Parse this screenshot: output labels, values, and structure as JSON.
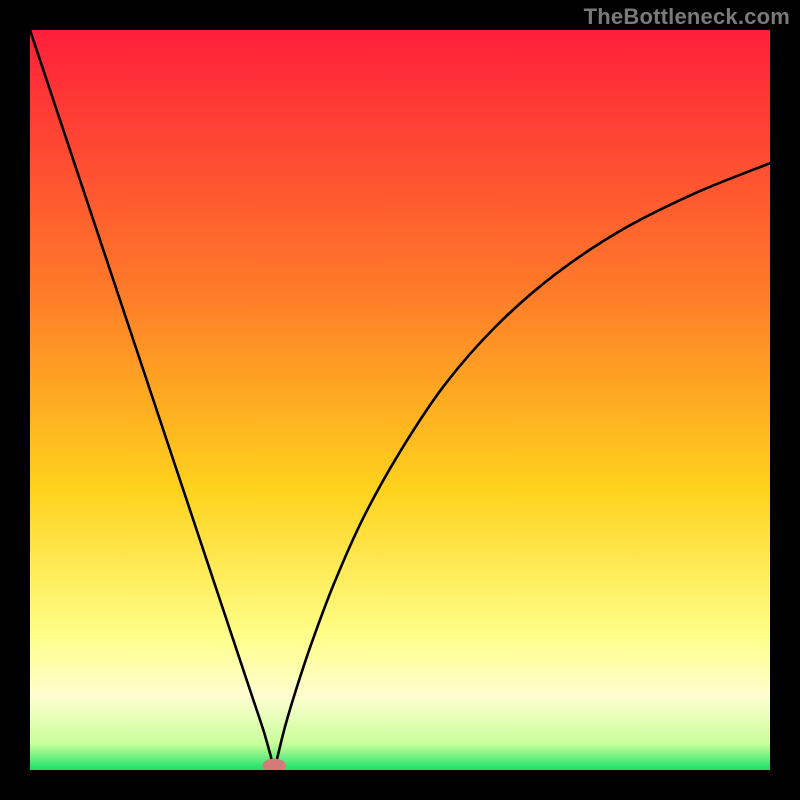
{
  "watermark": "TheBottleneck.com",
  "colors": {
    "frame": "#000000",
    "gradient_top": "#ff1f3a",
    "gradient_mid1": "#ff7a2a",
    "gradient_mid2": "#ffd21c",
    "gradient_mid3": "#fffacd",
    "gradient_bottom": "#18e06a",
    "curve": "#000000",
    "marker": "#d57a7a"
  },
  "chart_data": {
    "type": "line",
    "title": "",
    "xlabel": "",
    "ylabel": "",
    "xlim": [
      0,
      100
    ],
    "ylim": [
      0,
      100
    ],
    "minimum": {
      "x": 33,
      "y": 0
    },
    "marker": {
      "x": 33,
      "y": 0,
      "rx": 1.6,
      "ry": 1.0
    },
    "series": [
      {
        "name": "bottleneck-curve",
        "x": [
          0,
          3,
          6,
          9,
          12,
          15,
          18,
          21,
          24,
          27,
          30,
          31.5,
          32.5,
          33,
          33.5,
          34.5,
          36,
          38,
          41,
          45,
          50,
          56,
          63,
          71,
          80,
          90,
          100
        ],
        "values": [
          100,
          91,
          82,
          73,
          64,
          55,
          46,
          37,
          28,
          19,
          10,
          5.5,
          2,
          0,
          2,
          6,
          11,
          17,
          25,
          34,
          43,
          52,
          60,
          67,
          73,
          78,
          82
        ]
      }
    ],
    "gradient_stops": [
      {
        "offset": 0.0,
        "color": "#ff1f3a"
      },
      {
        "offset": 0.35,
        "color": "#ff7a2a"
      },
      {
        "offset": 0.62,
        "color": "#ffd21c"
      },
      {
        "offset": 0.82,
        "color": "#ffff8a"
      },
      {
        "offset": 0.9,
        "color": "#fffdd0"
      },
      {
        "offset": 0.965,
        "color": "#c8ff9a"
      },
      {
        "offset": 1.0,
        "color": "#18e06a"
      }
    ]
  }
}
